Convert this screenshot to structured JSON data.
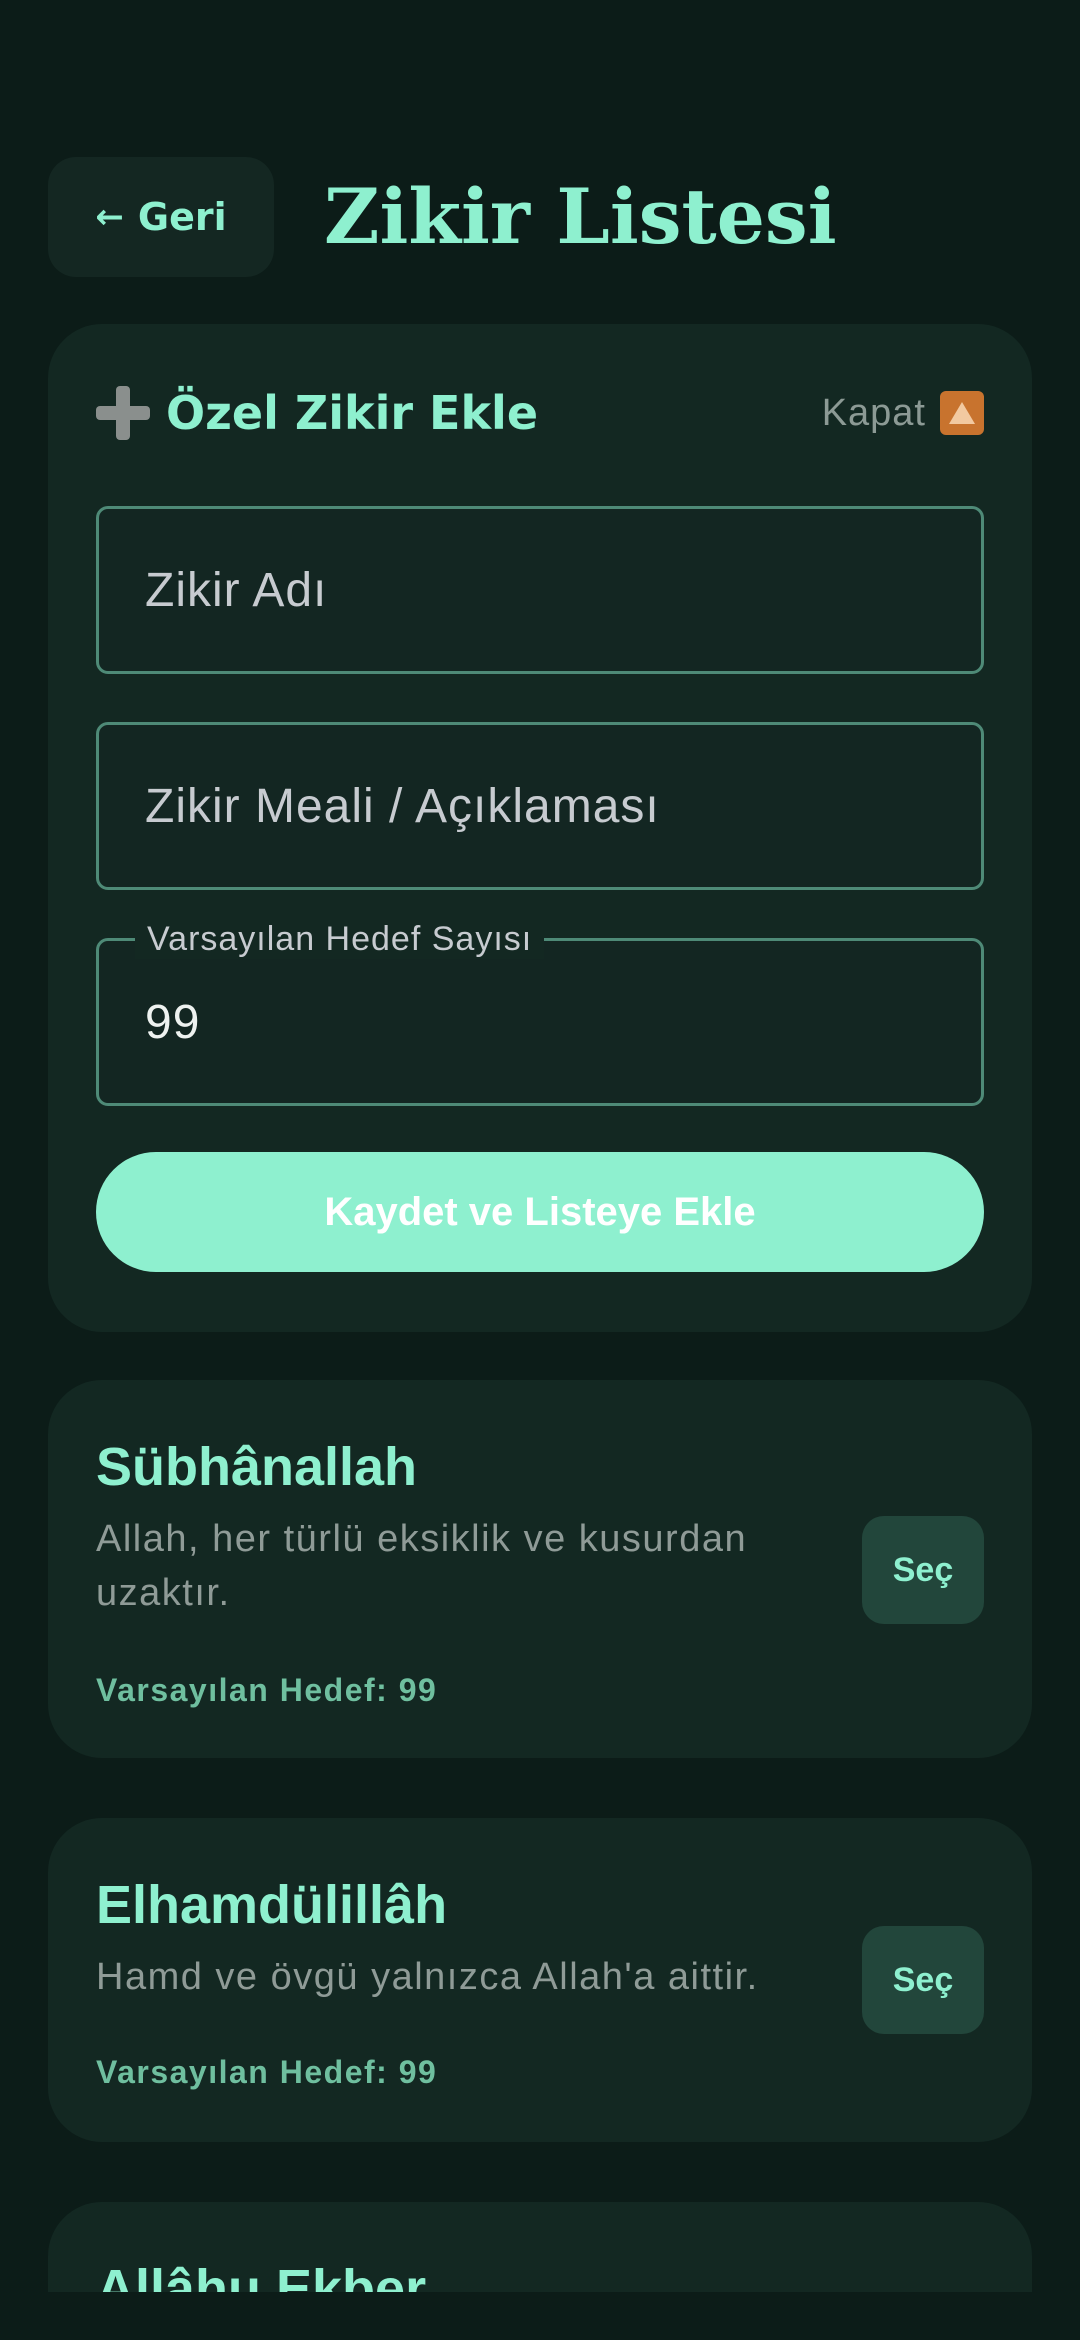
{
  "header": {
    "back_label": "Geri",
    "back_icon": "arrow-left-icon",
    "title": "Zikir Listesi"
  },
  "form": {
    "title": "Özel Zikir Ekle",
    "title_icon": "plus-icon",
    "close_label": "Kapat",
    "close_icon": "up-arrow-icon",
    "name_placeholder": "Zikir Adı",
    "desc_placeholder": "Zikir Meali / Açıklaması",
    "target_label": "Varsayılan Hedef Sayısı",
    "target_value": "99",
    "save_label": "Kaydet ve Listeye Ekle"
  },
  "items": [
    {
      "name": "Sübhânallah",
      "description": "Allah, her türlü eksiklik ve kusurdan uzaktır.",
      "target": "Varsayılan Hedef: 99",
      "select_label": "Seç"
    },
    {
      "name": "Elhamdülillâh",
      "description": "Hamd ve övgü yalnızca Allah'a aittir.",
      "target": "Varsayılan Hedef: 99",
      "select_label": "Seç"
    },
    {
      "name": "Allâhu Ekber"
    }
  ],
  "colors": {
    "background": "#0c1c18",
    "card": "#132822",
    "accent": "#8ef0cf",
    "muted_text": "#8f9b97",
    "field_border": "#4e8a77"
  }
}
